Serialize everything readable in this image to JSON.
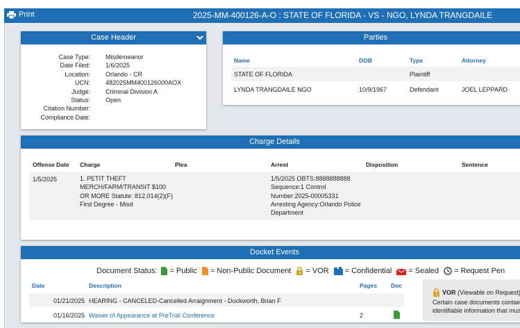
{
  "header": {
    "print_label": "Print",
    "title": "2025-MM-400126-A-O : STATE OF FLORIDA - VS - NGO, LYNDA TRANGDAILE"
  },
  "case_header": {
    "title": "Case Header",
    "fields": [
      {
        "label": "Case Type:",
        "value": "Misdemeanor"
      },
      {
        "label": "Date Filed:",
        "value": "1/6/2025"
      },
      {
        "label": "Location:",
        "value": "Orlando - CR"
      },
      {
        "label": "UCN:",
        "value": "482025MM400126000AOX"
      },
      {
        "label": "Judge:",
        "value": "Criminal Division A"
      },
      {
        "label": "Status:",
        "value": "Open"
      },
      {
        "label": "Citation Number:",
        "value": ""
      },
      {
        "label": "Compliance Date:",
        "value": ""
      }
    ]
  },
  "parties": {
    "title": "Parties",
    "columns": [
      "Name",
      "DOB",
      "Type",
      "Attorney"
    ],
    "rows": [
      {
        "name": "STATE OF FLORIDA",
        "dob": "",
        "type": "Plaintiff",
        "attorney": ""
      },
      {
        "name": "LYNDA TRANGDAILE NGO",
        "dob": "10/9/1967",
        "type": "Defendant",
        "attorney": "JOEL LEPPARD"
      }
    ]
  },
  "charges": {
    "title": "Charge Details",
    "columns": [
      "Offense Date",
      "Charge",
      "Plea",
      "Arrest",
      "Disposition",
      "Sentence"
    ],
    "row": {
      "offense_date": "1/5/2025",
      "charge_lines": [
        "1. PETIT THEFT",
        "MERCH/FARM/TRANSIT $100",
        "OR MORE Statute: 812.014(2)(F)",
        "First Degree - Misd"
      ],
      "arrest_lines": [
        "1/5/2025 OBTS:8888888888",
        "Sequence:1 Control",
        "Number:2025-00005331",
        "Arresting Agency:Orlando Police",
        "Department"
      ]
    }
  },
  "docket": {
    "title": "Docket Events",
    "legend": {
      "prefix": "Document Status:",
      "public": "= Public",
      "non_public": "= Non-Public Document",
      "vor": "= VOR",
      "confidential": "= Confidential",
      "sealed": "= Sealed",
      "request": "= Request Pen"
    },
    "columns": [
      "Date",
      "Description",
      "Pages",
      "Doc"
    ],
    "rows": [
      {
        "date": "01/21/2025",
        "description": "HEARING - CANCELED-Cancelled Arraignment - Duckworth, Brian F",
        "pages": ""
      },
      {
        "date": "01/16/2025",
        "description": "Waiver of Appearance at PreTrial Conference",
        "pages": "2"
      }
    ],
    "vor_note": {
      "title": "VOR",
      "subtitle": "(Viewable on Request)",
      "line1": "Certain case documents contain",
      "line2": "identifiable information that must"
    }
  },
  "colors": {
    "accent": "#1e6fb5",
    "public": "#3a9a3a",
    "non_public": "#f0912b",
    "vor": "#d6a51c",
    "confidential": "#1e6fb5",
    "sealed": "#d82020"
  }
}
